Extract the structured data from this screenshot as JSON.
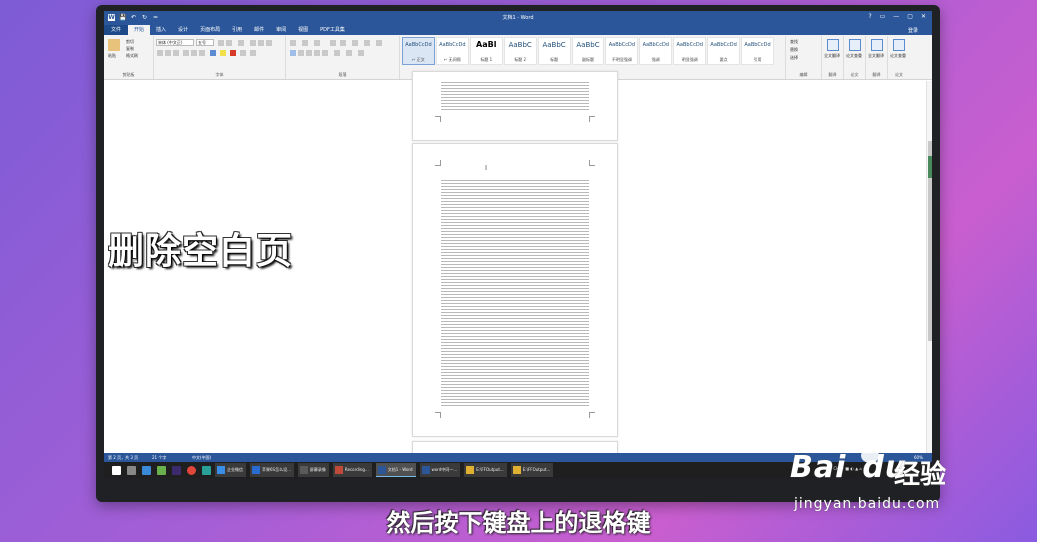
{
  "window": {
    "title": "文档1 - Word",
    "login": "登录",
    "controls": [
      "?",
      "▭",
      "—",
      "▢",
      "✕"
    ]
  },
  "quick_access": [
    "W",
    "💾",
    "↶",
    "↻",
    "="
  ],
  "tabs": [
    "文件",
    "开始",
    "插入",
    "设计",
    "页面布局",
    "引用",
    "邮件",
    "审阅",
    "视图",
    "PDF工具集"
  ],
  "active_tab": "开始",
  "ribbon": {
    "clipboard": {
      "paste": "粘贴",
      "cut": "剪切",
      "copy": "复制",
      "format_painter": "格式刷",
      "label": "剪贴板"
    },
    "font": {
      "family": "宋体 (中文正)",
      "size": "五号",
      "label": "字体"
    },
    "paragraph": {
      "label": "段落"
    },
    "styles": {
      "label": "样式",
      "items": [
        {
          "sample": "AaBbCcDd",
          "name": "↵ 正文"
        },
        {
          "sample": "AaBbCcDd",
          "name": "↵ 无间隔"
        },
        {
          "sample": "AaBl",
          "name": "标题 1"
        },
        {
          "sample": "AaBbC",
          "name": "标题 2"
        },
        {
          "sample": "AaBbC",
          "name": "标题"
        },
        {
          "sample": "AaBbC",
          "name": "副标题"
        },
        {
          "sample": "AaBbCcDd",
          "name": "不明显强调"
        },
        {
          "sample": "AaBbCcDd",
          "name": "强调"
        },
        {
          "sample": "AaBbCcDd",
          "name": "明显强调"
        },
        {
          "sample": "AaBbCcDd",
          "name": "要点"
        },
        {
          "sample": "AaBbCcDd",
          "name": "引用"
        },
        {
          "sample": "AaBbCcDd",
          "name": "明显引用"
        }
      ]
    },
    "editing": {
      "find": "查找",
      "replace": "替换",
      "select": "选择",
      "label": "编辑"
    },
    "extras": [
      {
        "name": "全文翻译",
        "label": "翻译"
      },
      {
        "name": "论文查重",
        "label": "论文"
      },
      {
        "name": "全文翻译",
        "label": "翻译"
      },
      {
        "name": "论文查重",
        "label": "论文"
      }
    ]
  },
  "status": {
    "page": "第 2 页，共 3 页",
    "words": "21 个字",
    "lang": "中文(中国)",
    "zoom": "60%"
  },
  "taskbar": {
    "items": [
      {
        "label": "企业微信",
        "color": "#3a8ee6"
      },
      {
        "label": "苹果6S怎么设...",
        "color": "#2a6bd1"
      },
      {
        "label": "屏幕录像",
        "color": "#5a5a5a"
      },
      {
        "label": "Recording...",
        "color": "#c04a3a"
      },
      {
        "label": "文档1 - Word",
        "color": "#2b579a"
      },
      {
        "label": "word中同一...",
        "color": "#2b579a"
      },
      {
        "label": "E:\\FFOutput...",
        "color": "#e0b030"
      },
      {
        "label": "E:\\FFOutput...",
        "color": "#e0b030"
      }
    ],
    "tray": "CH ⚑ ■ ◐ ▲ ⌂"
  },
  "overlay": {
    "title": "删除空白页",
    "subtitle": "然后按下键盘上的退格键"
  },
  "watermark": {
    "brand_latin": "Bai",
    "brand_latin2": "du",
    "brand_cn": "经验",
    "url": "jingyan.baidu.com"
  }
}
